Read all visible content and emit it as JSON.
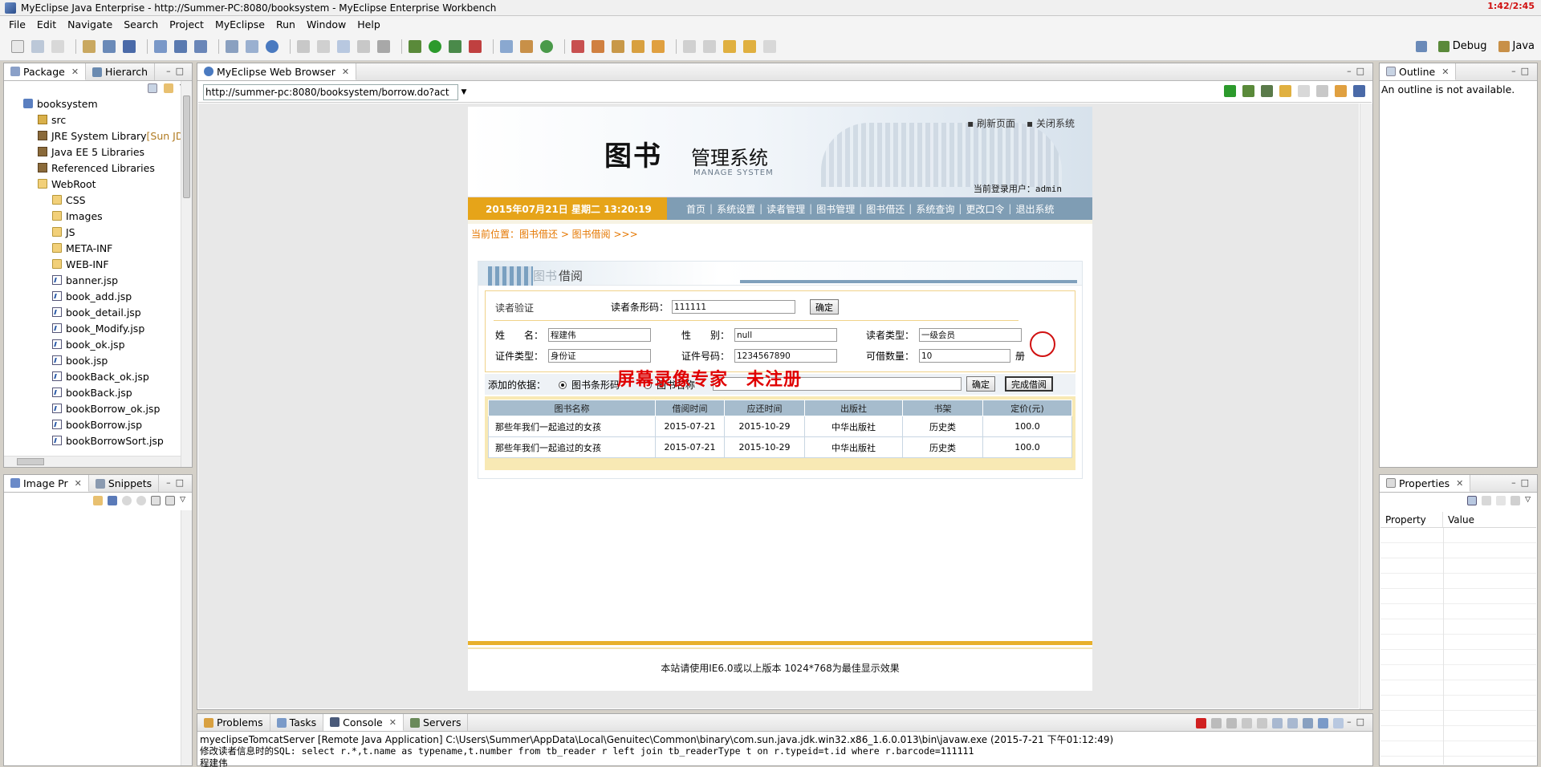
{
  "window": {
    "title": "MyEclipse Java Enterprise - http://Summer-PC:8080/booksystem - MyEclipse Enterprise Workbench",
    "clock": "1:42/2:45"
  },
  "menu": [
    "File",
    "Edit",
    "Navigate",
    "Search",
    "Project",
    "MyEclipse",
    "Run",
    "Window",
    "Help"
  ],
  "perspectives": {
    "debug": "Debug",
    "java": "Java"
  },
  "package_explorer": {
    "tab_active": "Package",
    "tab_other": "Hierarch",
    "tree": [
      {
        "label": "booksystem",
        "icon": "project-icon",
        "indent": 0
      },
      {
        "label": "src",
        "icon": "source-folder-icon",
        "indent": 1
      },
      {
        "label": "JRE System Library",
        "suffix": " [Sun JD",
        "icon": "library-icon",
        "indent": 1
      },
      {
        "label": "Java EE 5 Libraries",
        "icon": "library-icon",
        "indent": 1
      },
      {
        "label": "Referenced Libraries",
        "icon": "library-icon",
        "indent": 1
      },
      {
        "label": "WebRoot",
        "icon": "folder-icon",
        "indent": 1
      },
      {
        "label": "CSS",
        "icon": "folder-icon",
        "indent": 2
      },
      {
        "label": "Images",
        "icon": "folder-icon",
        "indent": 2
      },
      {
        "label": "JS",
        "icon": "folder-icon",
        "indent": 2
      },
      {
        "label": "META-INF",
        "icon": "folder-icon",
        "indent": 2
      },
      {
        "label": "WEB-INF",
        "icon": "folder-icon",
        "indent": 2
      },
      {
        "label": "banner.jsp",
        "icon": "jsp-file-icon",
        "indent": 2
      },
      {
        "label": "book_add.jsp",
        "icon": "jsp-file-icon",
        "indent": 2
      },
      {
        "label": "book_detail.jsp",
        "icon": "jsp-file-icon",
        "indent": 2
      },
      {
        "label": "book_Modify.jsp",
        "icon": "jsp-file-icon",
        "indent": 2
      },
      {
        "label": "book_ok.jsp",
        "icon": "jsp-file-icon",
        "indent": 2
      },
      {
        "label": "book.jsp",
        "icon": "jsp-file-icon",
        "indent": 2
      },
      {
        "label": "bookBack_ok.jsp",
        "icon": "jsp-file-icon",
        "indent": 2
      },
      {
        "label": "bookBack.jsp",
        "icon": "jsp-file-icon",
        "indent": 2
      },
      {
        "label": "bookBorrow_ok.jsp",
        "icon": "jsp-file-icon",
        "indent": 2
      },
      {
        "label": "bookBorrow.jsp",
        "icon": "jsp-file-icon",
        "indent": 2
      },
      {
        "label": "bookBorrowSort.jsp",
        "icon": "jsp-file-icon",
        "indent": 2
      }
    ]
  },
  "image_panel": {
    "tab_active": "Image Pr",
    "tab_other": "Snippets"
  },
  "browser": {
    "tab_label": "MyEclipse Web Browser",
    "url": "http://summer-pc:8080/booksystem/borrow.do?act"
  },
  "webpage": {
    "toplinks": [
      "刷新页面",
      "关闭系统"
    ],
    "logo_cn_big": "图书",
    "logo_cn_small": "管理系统",
    "logo_en": "MANAGE SYSTEM",
    "user_label": "当前登录用户：",
    "user_name": "admin",
    "date": "2015年07月21日 星期二 13:20:19",
    "nav": [
      "首页",
      "系统设置",
      "读者管理",
      "图书管理",
      "图书借还",
      "系统查询",
      "更改口令",
      "退出系统"
    ],
    "breadcrumb": "当前位置：图书借还 > 图书借阅 >>>",
    "card_title_a": "图书",
    "card_title_b": "借阅",
    "reader": {
      "verify_label": "读者验证",
      "barcode_label": "读者条形码：",
      "barcode_value": "111111",
      "confirm": "确定",
      "name_label": "姓　　名：",
      "name_value": "程建伟",
      "gender_label": "性　　别：",
      "gender_value": "null",
      "type_label": "读者类型：",
      "type_value": "一级会员",
      "idtype_label": "证件类型：",
      "idtype_value": "身份证",
      "idno_label": "证件号码：",
      "idno_value": "1234567890",
      "quota_label": "可借数量：",
      "quota_value": "10",
      "quota_unit": "册"
    },
    "add": {
      "label": "添加的依据：",
      "opt1": "图书条形码",
      "opt2": "图书名称",
      "confirm": "确定",
      "finish": "完成借阅"
    },
    "table": {
      "headers": [
        "图书名称",
        "借阅时间",
        "应还时间",
        "出版社",
        "书架",
        "定价(元)"
      ],
      "rows": [
        [
          "那些年我们一起追过的女孩",
          "2015-07-21",
          "2015-10-29",
          "中华出版社",
          "历史类",
          "100.0"
        ],
        [
          "那些年我们一起追过的女孩",
          "2015-07-21",
          "2015-10-29",
          "中华出版社",
          "历史类",
          "100.0"
        ]
      ]
    },
    "watermark": "屏幕录像专家　未注册",
    "footer": "本站请使用IE6.0或以上版本 1024*768为最佳显示效果"
  },
  "outline": {
    "tab": "Outline",
    "message": "An outline is not available."
  },
  "properties": {
    "tab": "Properties",
    "col1": "Property",
    "col2": "Value"
  },
  "console": {
    "tabs": [
      "Problems",
      "Tasks",
      "Console",
      "Servers"
    ],
    "header": "myeclipseTomcatServer [Remote Java Application] C:\\Users\\Summer\\AppData\\Local\\Genuitec\\Common\\binary\\com.sun.java.jdk.win32.x86_1.6.0.013\\bin\\javaw.exe (2015-7-21 下午01:12:49)",
    "line1": "修改读者信息时的SQL: select r.*,t.name as typename,t.number from tb_reader r left join tb_readerType t on r.typeid=t.id where r.barcode=111111",
    "line2": "程建伟"
  },
  "colors": {
    "accent_orange": "#e6a419",
    "nav_blue": "#7f9db4",
    "watermark_red": "#e00000"
  }
}
